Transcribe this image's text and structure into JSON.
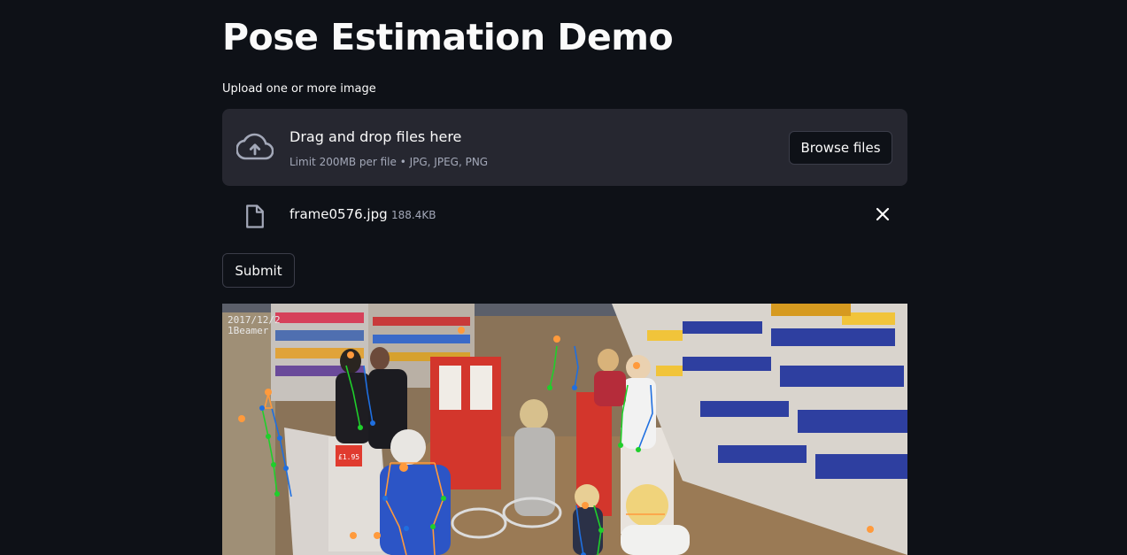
{
  "page": {
    "title": "Pose Estimation Demo"
  },
  "uploader": {
    "label": "Upload one or more image",
    "dropzone_title": "Drag and drop files here",
    "dropzone_limits": "Limit 200MB per file • JPG, JPEG, PNG",
    "browse_label": "Browse files",
    "upload_icon": "cloud-upload-icon"
  },
  "uploaded_file": {
    "name": "frame0576.jpg",
    "size": "188.4KB",
    "file_icon": "file-icon",
    "remove_icon": "close-icon"
  },
  "actions": {
    "submit_label": "Submit"
  },
  "result": {
    "timestamp_overlay": "2017/12/2",
    "camera_overlay": "1Beamer",
    "price_tag": "£1.95",
    "skeleton_colors": {
      "left_limb": "#1fcf2b",
      "right_limb": "#1f6fe0",
      "head": "#ff9a3c"
    }
  },
  "colors": {
    "background": "#0e1117",
    "dropzone": "#262730",
    "text_primary": "#fafafa",
    "text_secondary": "#a3a8b8",
    "button_border": "#3b3d49"
  }
}
